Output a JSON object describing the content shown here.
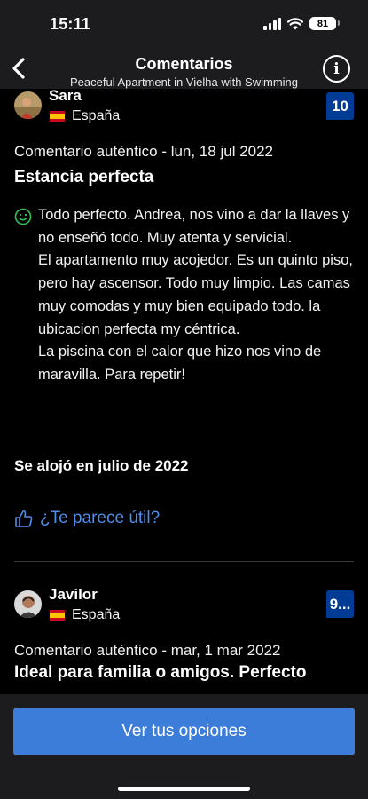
{
  "status_bar": {
    "time": "15:11",
    "battery": "81"
  },
  "header": {
    "title": "Comentarios",
    "subtitle": "Peaceful Apartment in Vielha with Swimming"
  },
  "reviews": [
    {
      "name": "Sara",
      "country": "España",
      "score": "10",
      "meta": "Comentario auténtico - lun, 18 jul 2022",
      "headline": "Estancia perfecta",
      "body": "Todo perfecto. Andrea, nos vino a dar la llaves y no enseñó todo. Muy atenta y servicial.\nEl apartamento muy acojedor. Es un quinto piso, pero hay ascensor. Todo muy limpio. Las camas muy comodas y muy bien equipado todo. la ubicacion perfecta my céntrica.\nLa piscina con el calor que hizo nos vino de maravilla. Para repetir!",
      "stayed": "Se alojó en julio de 2022",
      "helpful": "¿Te parece útil?"
    },
    {
      "name": "Javilor",
      "country": "España",
      "score": "9...",
      "meta": "Comentario auténtico - mar, 1 mar 2022",
      "headline": "Ideal para familia o amigos. Perfecto"
    }
  ],
  "cta": {
    "label": "Ver tus opciones"
  },
  "colors": {
    "accent": "#3b7dd8",
    "score_bg": "#003b95",
    "link": "#4d8eea"
  }
}
